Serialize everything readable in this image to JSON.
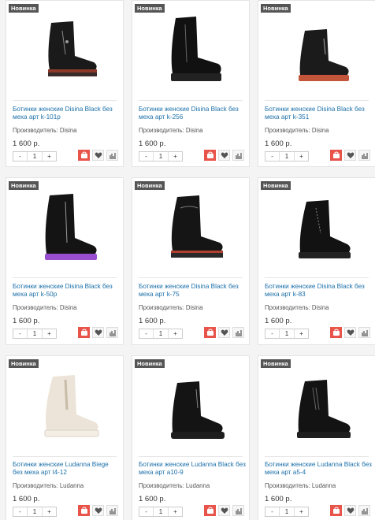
{
  "colors": {
    "title_link": "#1b6fa8",
    "badge_bg": "#555555",
    "cart_button": "#e8534a"
  },
  "products": [
    {
      "badge": "Новинка",
      "title": "Ботинки женские Disina Black без меха арт k-101p",
      "brand": "Производитель: Disina",
      "price": "1 600 р.",
      "qty": "1",
      "minus": "-",
      "plus": "+",
      "image": "black-suede-boot-red-sole"
    },
    {
      "badge": "Новинка",
      "title": "Ботинки женские Disina Black без меха арт k-256",
      "brand": "Производитель: Disina",
      "price": "1 600 р.",
      "qty": "1",
      "minus": "-",
      "plus": "+",
      "image": "black-leather-boot"
    },
    {
      "badge": "Новинка",
      "title": "Ботинки женские Disina Black без меха арт k-351",
      "brand": "Производитель: Disina",
      "price": "1 600 р.",
      "qty": "1",
      "minus": "-",
      "plus": "+",
      "image": "black-boot-orange-sole"
    },
    {
      "badge": "Новинка",
      "title": "Ботинки женские Disina Black без меха арт k-50p",
      "brand": "Производитель: Disina",
      "price": "1 600 р.",
      "qty": "1",
      "minus": "-",
      "plus": "+",
      "image": "black-suede-boot-purple-sole"
    },
    {
      "badge": "Новинка",
      "title": "Ботинки женские Disina Black без меха арт k-75",
      "brand": "Производитель: Disina",
      "price": "1 600 р.",
      "qty": "1",
      "minus": "-",
      "plus": "+",
      "image": "black-boot-red-stripe"
    },
    {
      "badge": "Новинка",
      "title": "Ботинки женские Disina Black без меха арт k-83",
      "brand": "Производитель: Disina",
      "price": "1 600 р.",
      "qty": "1",
      "minus": "-",
      "plus": "+",
      "image": "black-lace-boot"
    },
    {
      "badge": "Новинка",
      "title": "Ботинки женские Ludanna Biege без меха арт l4-12",
      "brand": "Производитель: Ludanna",
      "price": "1 600 р.",
      "qty": "1",
      "minus": "-",
      "plus": "+",
      "image": "beige-chelsea-boot"
    },
    {
      "badge": "Новинка",
      "title": "Ботинки женские Ludanna Black без меха арт a10-9",
      "brand": "Производитель: Ludanna",
      "price": "1 600 р.",
      "qty": "1",
      "minus": "-",
      "plus": "+",
      "image": "black-chelsea-boot"
    },
    {
      "badge": "Новинка",
      "title": "Ботинки женские Ludanna Black без меха арт a5-4",
      "brand": "Производитель: Ludanna",
      "price": "1 600 р.",
      "qty": "1",
      "minus": "-",
      "plus": "+",
      "image": "black-chelsea-boot-elastic"
    }
  ],
  "icons": {
    "cart": "cart-icon",
    "wishlist": "heart-icon",
    "compare": "compare-chart-icon"
  }
}
